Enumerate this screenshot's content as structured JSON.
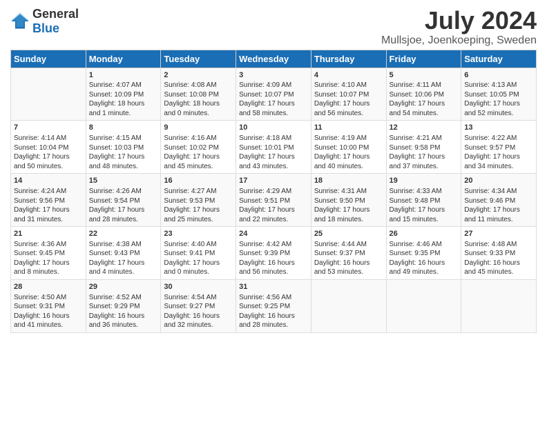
{
  "logo": {
    "general": "General",
    "blue": "Blue"
  },
  "title": "July 2024",
  "subtitle": "Mullsjoe, Joenkoeping, Sweden",
  "days": [
    "Sunday",
    "Monday",
    "Tuesday",
    "Wednesday",
    "Thursday",
    "Friday",
    "Saturday"
  ],
  "weeks": [
    [
      {
        "date": "",
        "sunrise": "",
        "sunset": "",
        "daylight": ""
      },
      {
        "date": "1",
        "sunrise": "Sunrise: 4:07 AM",
        "sunset": "Sunset: 10:09 PM",
        "daylight": "Daylight: 18 hours and 1 minute."
      },
      {
        "date": "2",
        "sunrise": "Sunrise: 4:08 AM",
        "sunset": "Sunset: 10:08 PM",
        "daylight": "Daylight: 18 hours and 0 minutes."
      },
      {
        "date": "3",
        "sunrise": "Sunrise: 4:09 AM",
        "sunset": "Sunset: 10:07 PM",
        "daylight": "Daylight: 17 hours and 58 minutes."
      },
      {
        "date": "4",
        "sunrise": "Sunrise: 4:10 AM",
        "sunset": "Sunset: 10:07 PM",
        "daylight": "Daylight: 17 hours and 56 minutes."
      },
      {
        "date": "5",
        "sunrise": "Sunrise: 4:11 AM",
        "sunset": "Sunset: 10:06 PM",
        "daylight": "Daylight: 17 hours and 54 minutes."
      },
      {
        "date": "6",
        "sunrise": "Sunrise: 4:13 AM",
        "sunset": "Sunset: 10:05 PM",
        "daylight": "Daylight: 17 hours and 52 minutes."
      }
    ],
    [
      {
        "date": "7",
        "sunrise": "Sunrise: 4:14 AM",
        "sunset": "Sunset: 10:04 PM",
        "daylight": "Daylight: 17 hours and 50 minutes."
      },
      {
        "date": "8",
        "sunrise": "Sunrise: 4:15 AM",
        "sunset": "Sunset: 10:03 PM",
        "daylight": "Daylight: 17 hours and 48 minutes."
      },
      {
        "date": "9",
        "sunrise": "Sunrise: 4:16 AM",
        "sunset": "Sunset: 10:02 PM",
        "daylight": "Daylight: 17 hours and 45 minutes."
      },
      {
        "date": "10",
        "sunrise": "Sunrise: 4:18 AM",
        "sunset": "Sunset: 10:01 PM",
        "daylight": "Daylight: 17 hours and 43 minutes."
      },
      {
        "date": "11",
        "sunrise": "Sunrise: 4:19 AM",
        "sunset": "Sunset: 10:00 PM",
        "daylight": "Daylight: 17 hours and 40 minutes."
      },
      {
        "date": "12",
        "sunrise": "Sunrise: 4:21 AM",
        "sunset": "Sunset: 9:58 PM",
        "daylight": "Daylight: 17 hours and 37 minutes."
      },
      {
        "date": "13",
        "sunrise": "Sunrise: 4:22 AM",
        "sunset": "Sunset: 9:57 PM",
        "daylight": "Daylight: 17 hours and 34 minutes."
      }
    ],
    [
      {
        "date": "14",
        "sunrise": "Sunrise: 4:24 AM",
        "sunset": "Sunset: 9:56 PM",
        "daylight": "Daylight: 17 hours and 31 minutes."
      },
      {
        "date": "15",
        "sunrise": "Sunrise: 4:26 AM",
        "sunset": "Sunset: 9:54 PM",
        "daylight": "Daylight: 17 hours and 28 minutes."
      },
      {
        "date": "16",
        "sunrise": "Sunrise: 4:27 AM",
        "sunset": "Sunset: 9:53 PM",
        "daylight": "Daylight: 17 hours and 25 minutes."
      },
      {
        "date": "17",
        "sunrise": "Sunrise: 4:29 AM",
        "sunset": "Sunset: 9:51 PM",
        "daylight": "Daylight: 17 hours and 22 minutes."
      },
      {
        "date": "18",
        "sunrise": "Sunrise: 4:31 AM",
        "sunset": "Sunset: 9:50 PM",
        "daylight": "Daylight: 17 hours and 18 minutes."
      },
      {
        "date": "19",
        "sunrise": "Sunrise: 4:33 AM",
        "sunset": "Sunset: 9:48 PM",
        "daylight": "Daylight: 17 hours and 15 minutes."
      },
      {
        "date": "20",
        "sunrise": "Sunrise: 4:34 AM",
        "sunset": "Sunset: 9:46 PM",
        "daylight": "Daylight: 17 hours and 11 minutes."
      }
    ],
    [
      {
        "date": "21",
        "sunrise": "Sunrise: 4:36 AM",
        "sunset": "Sunset: 9:45 PM",
        "daylight": "Daylight: 17 hours and 8 minutes."
      },
      {
        "date": "22",
        "sunrise": "Sunrise: 4:38 AM",
        "sunset": "Sunset: 9:43 PM",
        "daylight": "Daylight: 17 hours and 4 minutes."
      },
      {
        "date": "23",
        "sunrise": "Sunrise: 4:40 AM",
        "sunset": "Sunset: 9:41 PM",
        "daylight": "Daylight: 17 hours and 0 minutes."
      },
      {
        "date": "24",
        "sunrise": "Sunrise: 4:42 AM",
        "sunset": "Sunset: 9:39 PM",
        "daylight": "Daylight: 16 hours and 56 minutes."
      },
      {
        "date": "25",
        "sunrise": "Sunrise: 4:44 AM",
        "sunset": "Sunset: 9:37 PM",
        "daylight": "Daylight: 16 hours and 53 minutes."
      },
      {
        "date": "26",
        "sunrise": "Sunrise: 4:46 AM",
        "sunset": "Sunset: 9:35 PM",
        "daylight": "Daylight: 16 hours and 49 minutes."
      },
      {
        "date": "27",
        "sunrise": "Sunrise: 4:48 AM",
        "sunset": "Sunset: 9:33 PM",
        "daylight": "Daylight: 16 hours and 45 minutes."
      }
    ],
    [
      {
        "date": "28",
        "sunrise": "Sunrise: 4:50 AM",
        "sunset": "Sunset: 9:31 PM",
        "daylight": "Daylight: 16 hours and 41 minutes."
      },
      {
        "date": "29",
        "sunrise": "Sunrise: 4:52 AM",
        "sunset": "Sunset: 9:29 PM",
        "daylight": "Daylight: 16 hours and 36 minutes."
      },
      {
        "date": "30",
        "sunrise": "Sunrise: 4:54 AM",
        "sunset": "Sunset: 9:27 PM",
        "daylight": "Daylight: 16 hours and 32 minutes."
      },
      {
        "date": "31",
        "sunrise": "Sunrise: 4:56 AM",
        "sunset": "Sunset: 9:25 PM",
        "daylight": "Daylight: 16 hours and 28 minutes."
      },
      {
        "date": "",
        "sunrise": "",
        "sunset": "",
        "daylight": ""
      },
      {
        "date": "",
        "sunrise": "",
        "sunset": "",
        "daylight": ""
      },
      {
        "date": "",
        "sunrise": "",
        "sunset": "",
        "daylight": ""
      }
    ]
  ]
}
